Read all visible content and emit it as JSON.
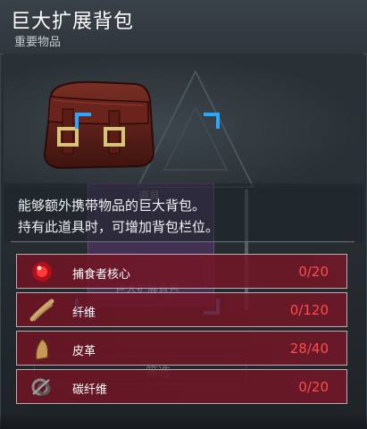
{
  "item": {
    "title": "巨大扩展背包",
    "category": "重要物品",
    "description": [
      "能够额外携带物品的巨大背包。",
      "持有此道具时，可增加背包栏位。"
    ]
  },
  "background": {
    "ghost_label_top": "道具",
    "ghost_label_name": "巨大扩展背包",
    "ghost_search": "筛选"
  },
  "materials": [
    {
      "name": "捕食者核心",
      "count": "0/20",
      "icon": "predator-core-icon"
    },
    {
      "name": "纤维",
      "count": "0/120",
      "icon": "fiber-icon"
    },
    {
      "name": "皮革",
      "count": "28/40",
      "icon": "leather-icon"
    },
    {
      "name": "碳纤维",
      "count": "0/20",
      "icon": "carbon-fiber-icon"
    }
  ],
  "colors": {
    "accent_blue": "#2aa7ff",
    "row_bg": "#7a1628",
    "insufficient_count": "#ff4b4b"
  }
}
